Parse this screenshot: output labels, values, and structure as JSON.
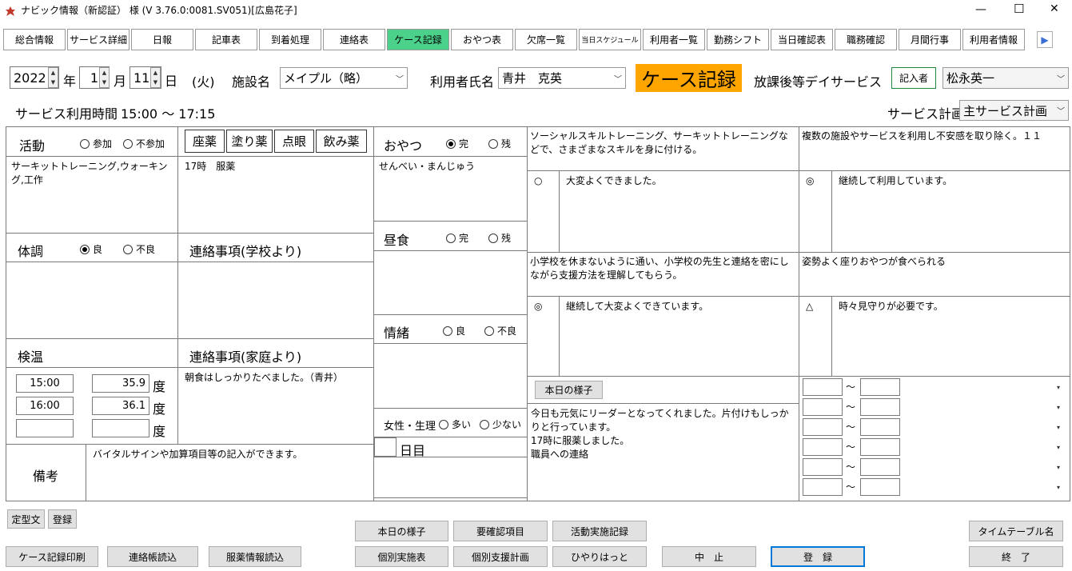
{
  "window": {
    "title": "ナビック情報（新認証） 様 (V 3.76.0:0081.SV051)[広島花子]",
    "minimize": "—",
    "maximize": "☐",
    "close": "✕"
  },
  "tabs": [
    "総合情報",
    "サービス詳細",
    "日報",
    "記車表",
    "到着処理",
    "連絡表",
    "ケース記録",
    "おやつ表",
    "欠席一覧",
    "当日スケジュール",
    "利用者一覧",
    "勤務シフト",
    "当日確認表",
    "職務確認",
    "月間行事",
    "利用者情報"
  ],
  "tab_next": "▶",
  "date": {
    "year": "2022",
    "year_unit": "年",
    "month": "1",
    "month_unit": "月",
    "day": "11",
    "day_unit": "日",
    "weekday": "(火)"
  },
  "facility": {
    "label": "施設名",
    "value": "メイプル（略）"
  },
  "user": {
    "label": "利用者氏名",
    "value": "青井　克英"
  },
  "record_title": "ケース記録",
  "service_type": "放課後等デイサービス",
  "writer": {
    "button": "記入者",
    "value": "松永英一"
  },
  "service_time": {
    "label": "サービス利用時間",
    "value": "15:00 ～ 17:15"
  },
  "service_plan": {
    "label": "サービス計画",
    "value": "主サービス計画"
  },
  "activity": {
    "label": "活動",
    "opt1": "参加",
    "opt2": "不参加",
    "text": "サーキットトレーニング,ウォーキング,工作"
  },
  "medicine": {
    "b1": "座薬",
    "b2": "塗り薬",
    "b3": "点眼",
    "b4": "飲み薬",
    "text": "17時　服薬"
  },
  "snack": {
    "label": "おやつ",
    "opt1": "完",
    "opt2": "残",
    "text": "せんべい・まんじゅう"
  },
  "condition": {
    "label": "体調",
    "opt1": "良",
    "opt2": "不良"
  },
  "school_contact": {
    "label": "連絡事項(学校より)"
  },
  "lunch": {
    "label": "昼食",
    "opt1": "完",
    "opt2": "残"
  },
  "emotion": {
    "label": "情緒",
    "opt1": "良",
    "opt2": "不良"
  },
  "temperature": {
    "label": "検温",
    "unit": "度",
    "rows": [
      {
        "time": "15:00",
        "value": "35.9"
      },
      {
        "time": "16:00",
        "value": "36.1"
      },
      {
        "time": "",
        "value": ""
      }
    ]
  },
  "home_contact": {
    "label": "連絡事項(家庭より)",
    "text": "朝食はしっかりたべました。（青井）"
  },
  "female": {
    "label": "女性・生理",
    "opt1": "多い",
    "opt2": "少ない",
    "day_unit": "日目"
  },
  "remarks": {
    "label": "備考",
    "text": "バイタルサインや加算項目等の記入ができます。"
  },
  "goals": [
    {
      "goal": "ソーシャルスキルトレーニング、サーキットトレーニングなどで、さまざまなスキルを身に付ける。",
      "mark": "○",
      "comment": "大変よくできました。"
    },
    {
      "goal": "複数の施設やサービスを利用し不安感を取り除く。１１",
      "mark": "◎",
      "comment": "継続して利用しています。"
    },
    {
      "goal": "小学校を休まないように通い、小学校の先生と連絡を密にしながら支援方法を理解してもらう。",
      "mark": "◎",
      "comment": "継続して大変よくできています。"
    },
    {
      "goal": "姿勢よく座りおやつが食べられる",
      "mark": "△",
      "comment": "時々見守りが必要です。"
    }
  ],
  "today": {
    "button": "本日の様子",
    "text": "今日も元気にリーダーとなってくれました。片付けもしっかりと行っています。\n17時に服薬しました。\n職員への連絡"
  },
  "range_sep": "～",
  "bottom": {
    "teikei": "定型文",
    "register_small": "登録",
    "print": "ケース記録印刷",
    "contact_read": "連絡帳読込",
    "med_read": "服薬情報読込",
    "today_btn": "本日の様子",
    "check_items": "要確認項目",
    "activity_record": "活動実施記録",
    "individual_table": "個別実施表",
    "support_plan": "個別支援計画",
    "hiyari": "ひやりはっと",
    "cancel": "中　止",
    "register": "登　録",
    "timetable": "タイムテーブル名",
    "exit": "終　了"
  },
  "colors": {
    "active_tab": "#4cd18a",
    "title_badge": "#ffa500",
    "writer_border": "#1e8a3c"
  }
}
